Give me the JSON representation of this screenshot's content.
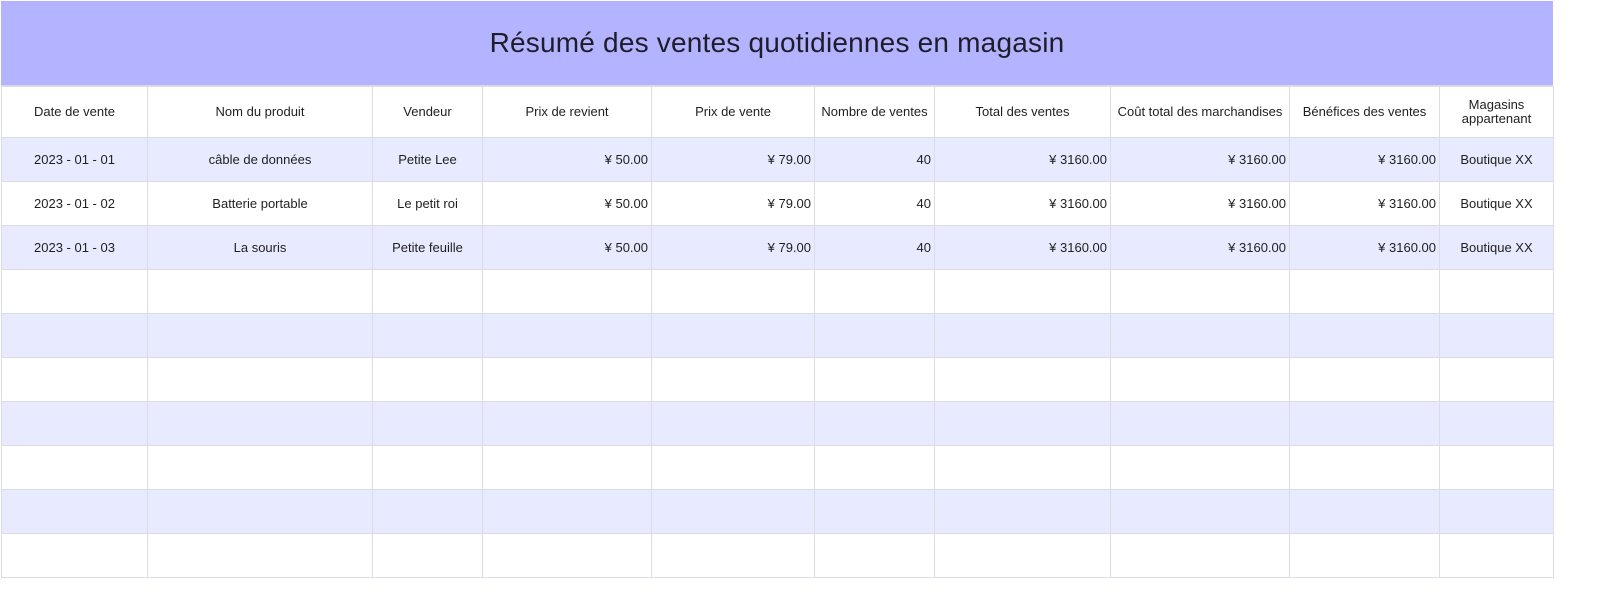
{
  "title": "Résumé des ventes quotidiennes en magasin",
  "columns": [
    "Date de vente",
    "Nom du produit",
    "Vendeur",
    "Prix de revient",
    "Prix de vente",
    "Nombre de ventes",
    "Total des ventes",
    "Coût total des marchandises",
    "Bénéfices des ventes",
    "Magasins appartenant"
  ],
  "rows": [
    [
      "2023 - 01 - 01",
      "câble de données",
      "Petite Lee",
      "¥ 50.00",
      "¥ 79.00",
      "40",
      "¥ 3160.00",
      "¥ 3160.00",
      "¥ 3160.00",
      "Boutique XX"
    ],
    [
      "2023 - 01 - 02",
      "Batterie portable",
      "Le petit roi",
      "¥ 50.00",
      "¥ 79.00",
      "40",
      "¥ 3160.00",
      "¥ 3160.00",
      "¥ 3160.00",
      "Boutique XX"
    ],
    [
      "2023 - 01 - 03",
      "La souris",
      "Petite feuille",
      "¥ 50.00",
      "¥ 79.00",
      "40",
      "¥ 3160.00",
      "¥ 3160.00",
      "¥ 3160.00",
      "Boutique XX"
    ],
    [
      "",
      "",
      "",
      "",
      "",
      "",
      "",
      "",
      "",
      ""
    ],
    [
      "",
      "",
      "",
      "",
      "",
      "",
      "",
      "",
      "",
      ""
    ],
    [
      "",
      "",
      "",
      "",
      "",
      "",
      "",
      "",
      "",
      ""
    ],
    [
      "",
      "",
      "",
      "",
      "",
      "",
      "",
      "",
      "",
      ""
    ],
    [
      "",
      "",
      "",
      "",
      "",
      "",
      "",
      "",
      "",
      ""
    ],
    [
      "",
      "",
      "",
      "",
      "",
      "",
      "",
      "",
      "",
      ""
    ],
    [
      "",
      "",
      "",
      "",
      "",
      "",
      "",
      "",
      "",
      ""
    ]
  ]
}
